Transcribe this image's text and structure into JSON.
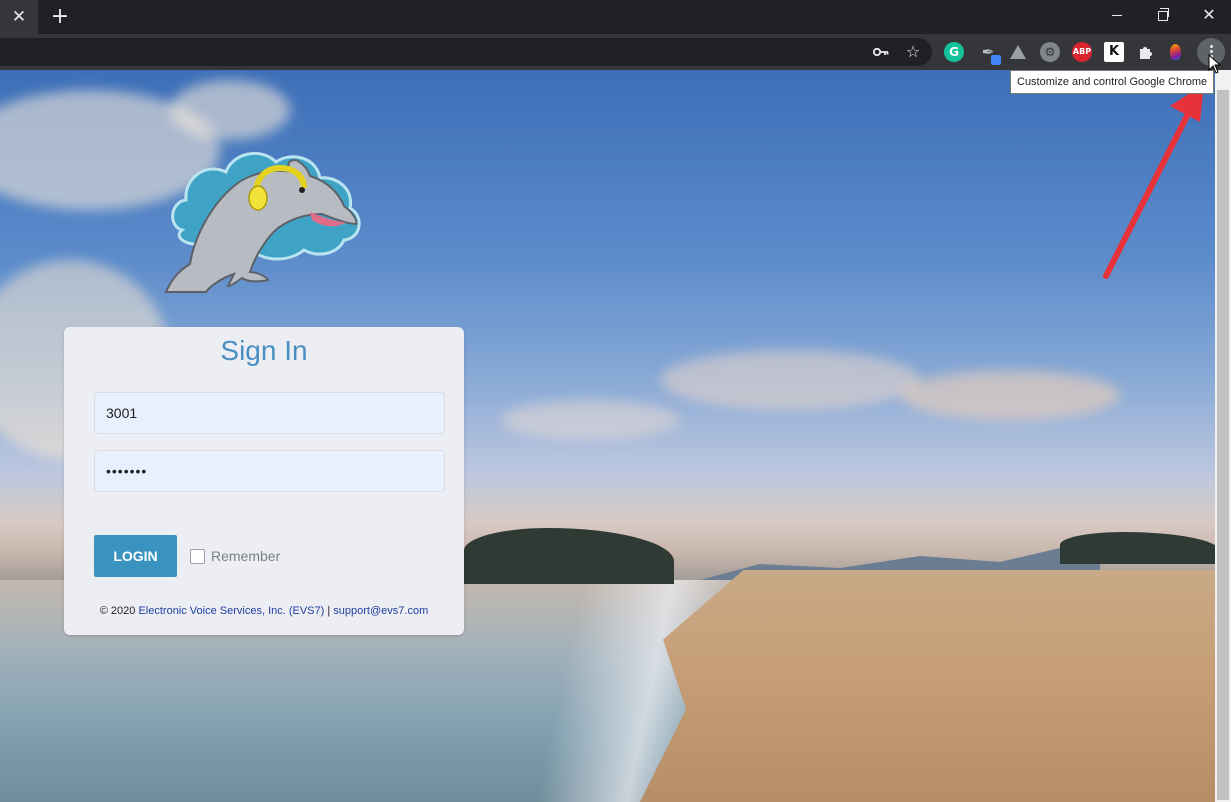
{
  "browser": {
    "tab_close_glyph": "✕",
    "new_tab_glyph": "+",
    "window_close_glyph": "✕",
    "tooltip": "Customize and control Google Chrome",
    "extensions": [
      {
        "name": "grammarly-icon",
        "glyph": "G"
      },
      {
        "name": "eyedropper-icon",
        "glyph": "✒"
      },
      {
        "name": "drive-icon",
        "glyph": ""
      },
      {
        "name": "gear-extension-icon",
        "glyph": "⚙"
      },
      {
        "name": "adblock-icon",
        "glyph": "ABP"
      },
      {
        "name": "k-extension-icon",
        "glyph": "K"
      },
      {
        "name": "puzzle-icon",
        "glyph": "✦"
      }
    ]
  },
  "login": {
    "title": "Sign In",
    "username_value": "3001",
    "password_value": "•••••••",
    "login_label": "LOGIN",
    "remember_label": "Remember",
    "footer_prefix": "© 2020 ",
    "footer_company": "Electronic Voice Services, Inc. (EVS7)",
    "footer_sep": " | ",
    "footer_email": "support@evs7.com"
  },
  "colors": {
    "accent": "#3a93bf",
    "title": "#4a8fc2",
    "annotation_arrow": "#e8323a"
  }
}
